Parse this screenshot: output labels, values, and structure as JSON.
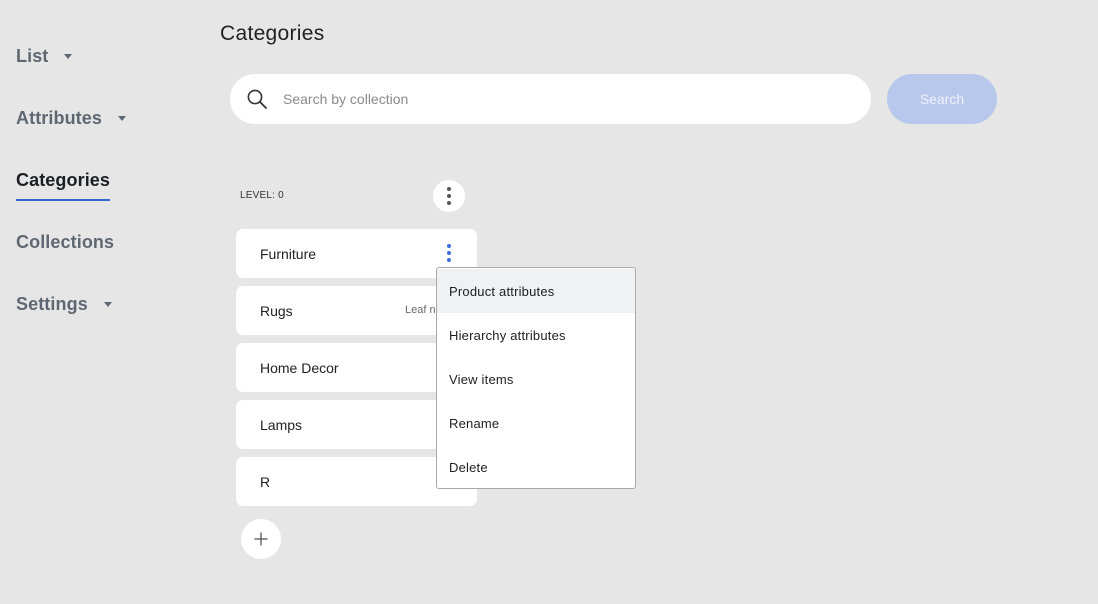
{
  "sidebar": {
    "items": [
      {
        "label": "List",
        "has_caret": true,
        "active": false
      },
      {
        "label": "Attributes",
        "has_caret": true,
        "active": false
      },
      {
        "label": "Categories",
        "has_caret": false,
        "active": true
      },
      {
        "label": "Collections",
        "has_caret": false,
        "active": false
      },
      {
        "label": "Settings",
        "has_caret": true,
        "active": false
      }
    ]
  },
  "page": {
    "title": "Categories"
  },
  "search": {
    "placeholder": "Search by collection",
    "button_label": "Search"
  },
  "level": {
    "label": "LEVEL: 0"
  },
  "categories": [
    {
      "name": "Furniture"
    },
    {
      "name": "Rugs",
      "badge": "Leaf n"
    },
    {
      "name": "Home Decor"
    },
    {
      "name": "Lamps"
    },
    {
      "name": "R"
    }
  ],
  "context_menu": {
    "items": [
      {
        "label": "Product attributes"
      },
      {
        "label": "Hierarchy attributes"
      },
      {
        "label": "View items"
      },
      {
        "label": "Rename"
      },
      {
        "label": "Delete"
      }
    ]
  },
  "colors": {
    "background": "#e6e6e6",
    "accent": "#3366cc",
    "search_button": "#b7c8ec",
    "menu_hover": "#f0f1f3"
  },
  "icons": {
    "search": "search-icon",
    "more": "more-vertical-icon",
    "add": "plus-icon",
    "caret": "caret-down-icon"
  }
}
